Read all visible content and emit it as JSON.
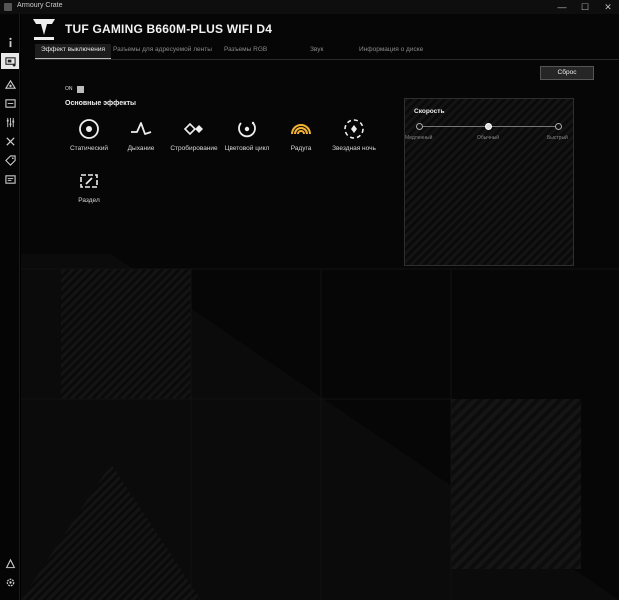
{
  "window": {
    "title": "Armoury Crate",
    "controls": [
      "—",
      "☐",
      "✕"
    ]
  },
  "sidebar": {
    "items": [
      {
        "icon": "info-icon"
      },
      {
        "icon": "device-icon",
        "active": true
      },
      {
        "icon": "aura-sync-icon"
      },
      {
        "icon": "system-diagnosis-icon"
      },
      {
        "icon": "fan-tuning-icon"
      },
      {
        "icon": "tools-icon"
      },
      {
        "icon": "deals-tag-icon"
      },
      {
        "icon": "news-icon"
      }
    ],
    "bottom": [
      {
        "icon": "user-center-icon"
      },
      {
        "icon": "settings-gear-icon"
      }
    ]
  },
  "header": {
    "product": "TUF GAMING B660M-PLUS WIFI D4",
    "logo_text": "TUF GAMING"
  },
  "tabs": [
    {
      "label": "Эффект выключения",
      "active": true
    },
    {
      "label": "Разъемы для адресуемой ленты"
    },
    {
      "label": "Разъемы RGB"
    },
    {
      "label": "Звук"
    },
    {
      "label": "Информация о диске"
    }
  ],
  "reset_label": "Сброс",
  "toggle": {
    "label": "ON",
    "state": "on"
  },
  "effects": {
    "title": "Основные эффекты",
    "items": [
      {
        "label": "Статический",
        "icon": "static-icon"
      },
      {
        "label": "Дыхание",
        "icon": "breathing-icon"
      },
      {
        "label": "Стробирование",
        "icon": "strobing-icon"
      },
      {
        "label": "Цветовой цикл",
        "icon": "color-cycle-icon"
      },
      {
        "label": "Радуга",
        "icon": "rainbow-icon"
      },
      {
        "label": "Звездная ночь",
        "icon": "starry-night-icon"
      },
      {
        "label": "Раздел",
        "icon": "section-icon"
      }
    ]
  },
  "speed": {
    "title": "Скорость",
    "options": [
      "Медленный",
      "Обычный",
      "Быстрый"
    ],
    "selected_index": 1
  },
  "colors": {
    "accent": "#f2b233",
    "background": "#060606",
    "panel_border": "#2f2f2f"
  }
}
